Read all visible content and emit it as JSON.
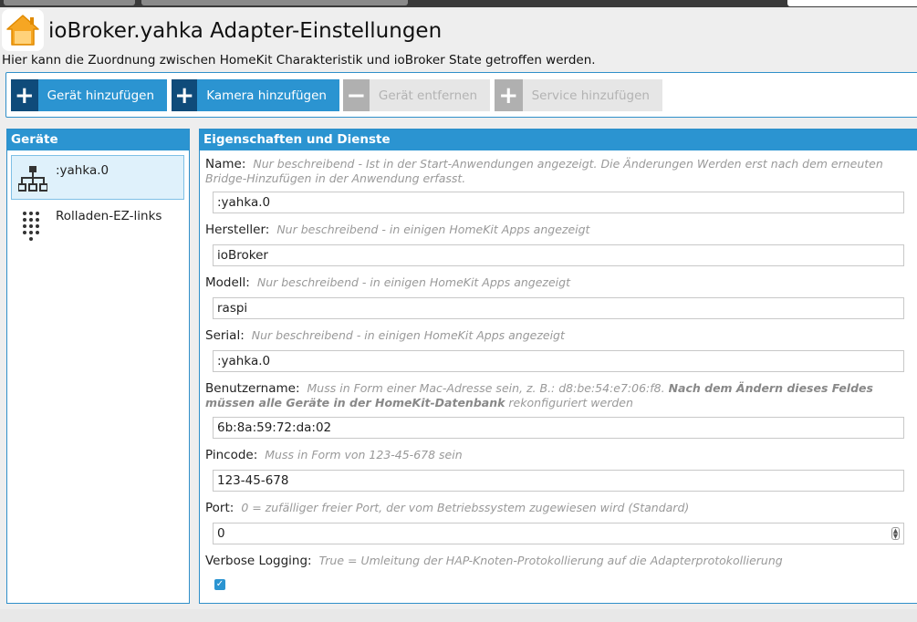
{
  "header": {
    "title": "ioBroker.yahka Adapter-Einstellungen",
    "subtitle": "Hier kann die Zuordnung zwischen HomeKit Charakteristik und ioBroker State getroffen werden."
  },
  "toolbar": {
    "add_device": "Gerät hinzufügen",
    "add_camera": "Kamera hinzufügen",
    "remove_device": "Gerät entfernen",
    "add_service": "Service hinzufügen"
  },
  "devices": {
    "header": "Geräte",
    "items": [
      {
        "label": ":yahka.0",
        "icon": "network-hierarchy-icon"
      },
      {
        "label": "Rolladen-EZ-links",
        "icon": "dot-grid-icon"
      }
    ]
  },
  "properties": {
    "header": "Eigenschaften und Dienste",
    "name": {
      "label": "Name:",
      "hint": "Nur beschreibend - Ist in der Start-Anwendungen angezeigt. Die Änderungen Werden erst nach dem erneuten Bridge-Hinzufügen in der Anwendung erfasst.",
      "value": ":yahka.0"
    },
    "manufacturer": {
      "label": "Hersteller:",
      "hint": "Nur beschreibend - in einigen HomeKit Apps angezeigt",
      "value": "ioBroker"
    },
    "model": {
      "label": "Modell:",
      "hint": "Nur beschreibend - in einigen HomeKit Apps angezeigt",
      "value": "raspi"
    },
    "serial": {
      "label": "Serial:",
      "hint": "Nur beschreibend - in einigen HomeKit Apps angezeigt",
      "value": ":yahka.0"
    },
    "username": {
      "label": "Benutzername:",
      "hint_a": "Muss in Form einer Mac-Adresse sein, z. B.: d8:be:54:e7:06:f8.",
      "hint_bold": "Nach dem Ändern dieses Feldes müssen alle Geräte in der HomeKit-Datenbank",
      "hint_b": "rekonfiguriert werden",
      "value": "6b:8a:59:72:da:02"
    },
    "pincode": {
      "label": "Pincode:",
      "hint": "Muss in Form von 123-45-678 sein",
      "value": "123-45-678"
    },
    "port": {
      "label": "Port:",
      "hint": "0 = zufälliger freier Port, der vom Betriebssystem zugewiesen wird (Standard)",
      "value": "0"
    },
    "verbose": {
      "label": "Verbose Logging:",
      "hint": "True = Umleitung der HAP-Knoten-Protokollierung auf die Adapterprotokollierung",
      "checked": true
    }
  },
  "colors": {
    "accent": "#2b94d1",
    "accent_dark": "#0f4b7a",
    "disabled": "#e6e6e6"
  }
}
